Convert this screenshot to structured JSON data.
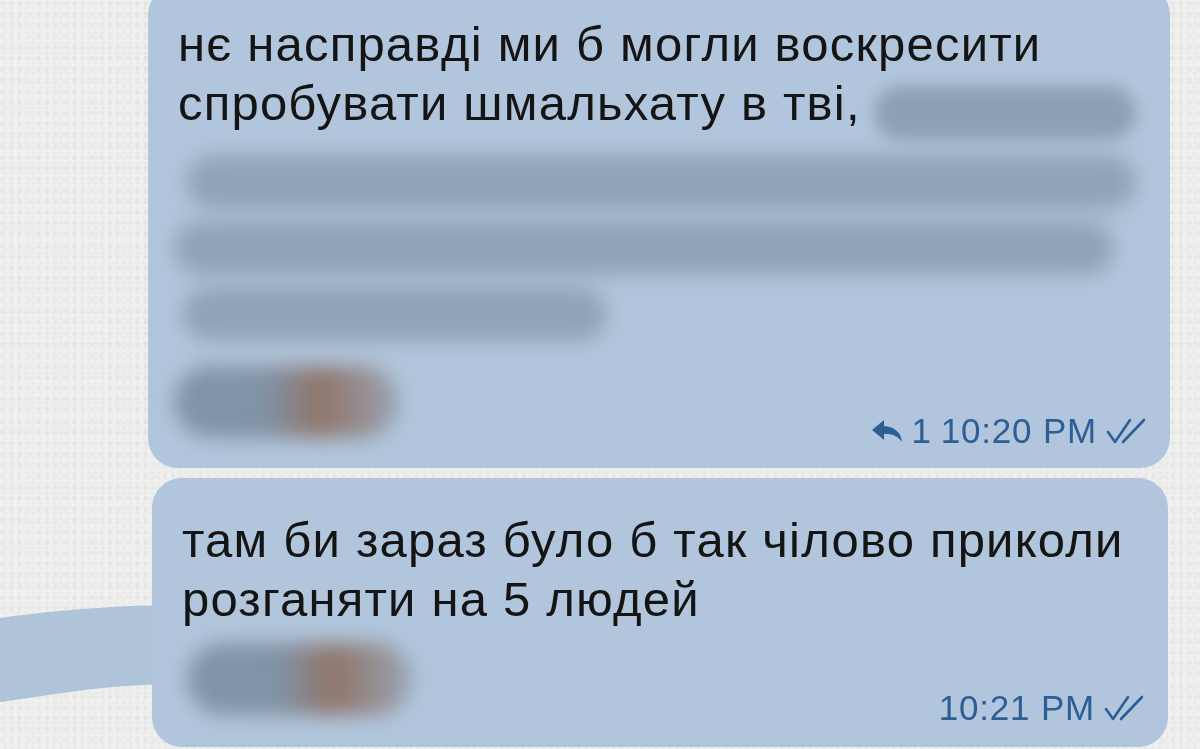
{
  "messages": [
    {
      "lines": [
        "нє насправді ми б могли воскресити",
        "спробувати шмальхату в тві,"
      ],
      "trailing_blur": true,
      "blocks": [
        {
          "kind": "blurred-text"
        },
        {
          "kind": "blurred-text"
        },
        {
          "kind": "blurred-text"
        },
        {
          "kind": "blurred-emoji"
        }
      ],
      "reply_count": "1",
      "time": "10:20 PM",
      "read": true
    },
    {
      "lines": [
        "там би зараз було б так чілово приколи",
        "розганяти на 5 людей"
      ],
      "trailing_blur": false,
      "blocks": [
        {
          "kind": "blurred-emoji"
        }
      ],
      "time": "10:21 PM",
      "read": true
    }
  ]
}
